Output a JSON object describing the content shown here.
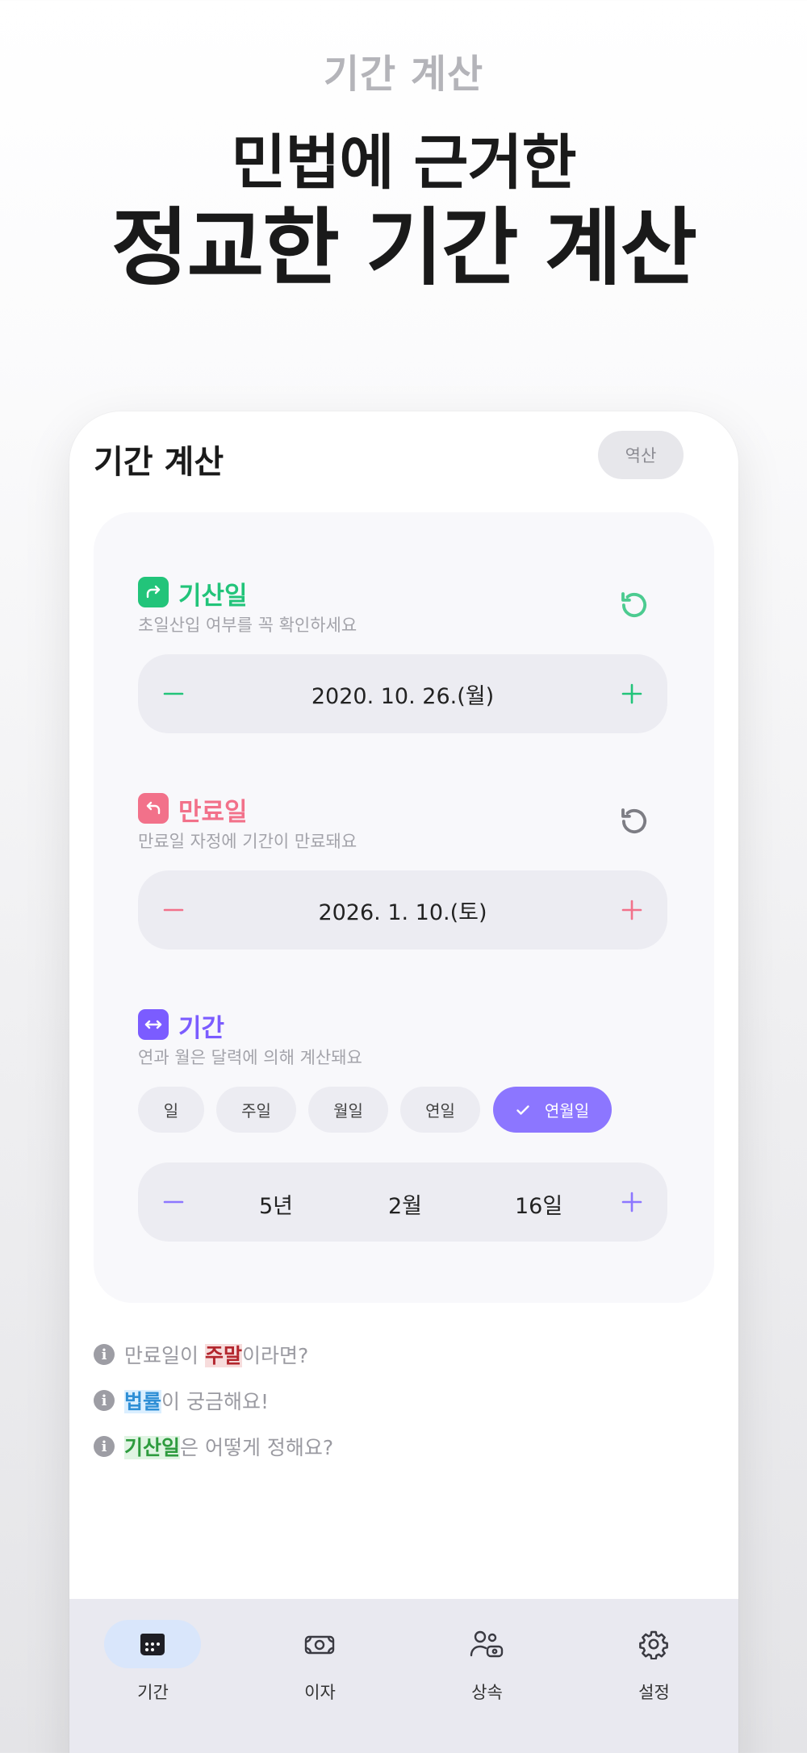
{
  "promo": {
    "subtitle": "기간 계산",
    "headline_1": "민법에 근거한",
    "headline_2": "정교한 기간 계산"
  },
  "header": {
    "title": "기간 계산",
    "reverse_label": "역산"
  },
  "start": {
    "title": "기산일",
    "desc": "초일산입 여부를 꼭 확인하세요",
    "value": "2020. 10. 26.(월)",
    "color": "#22c47a",
    "icon": "arrow-turn-right-icon"
  },
  "end": {
    "title": "만료일",
    "desc": "만료일 자정에 기간이 만료돼요",
    "value": "2026. 1. 10.(토)",
    "color": "#f2718a",
    "icon": "arrow-turn-left-icon"
  },
  "period": {
    "title": "기간",
    "desc": "연과 월은 달력에 의해 계산돼요",
    "color": "#7b5cff",
    "chips": [
      "일",
      "주일",
      "월일",
      "연일",
      "연월일"
    ],
    "selected_chip": "연월일",
    "years": "5년",
    "months": "2월",
    "days": "16일"
  },
  "info": [
    {
      "before": "만료일이 ",
      "highlight": "주말",
      "after": "이라면?"
    },
    {
      "before": "",
      "highlight": "법률",
      "after": "이 궁금해요!"
    },
    {
      "before": "",
      "highlight": "기산일",
      "after": "은 어떻게 정해요?"
    }
  ],
  "tabs": [
    {
      "label": "기간",
      "icon": "calendar-icon"
    },
    {
      "label": "이자",
      "icon": "money-icon"
    },
    {
      "label": "상속",
      "icon": "people-icon"
    },
    {
      "label": "설정",
      "icon": "gear-icon"
    }
  ],
  "colors": {
    "tab_active_bg": "#d9e6fb",
    "card_bg": "#f8f8fb"
  }
}
